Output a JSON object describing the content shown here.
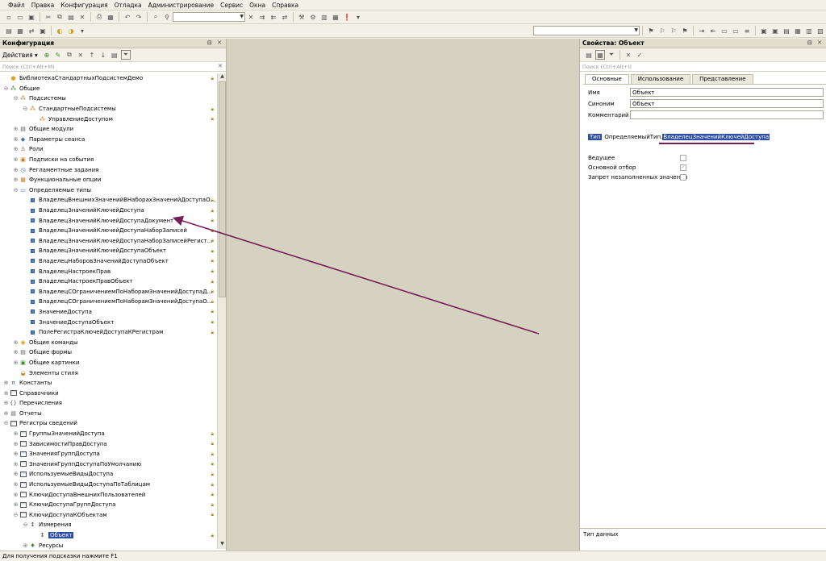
{
  "menu": [
    "Файл",
    "Правка",
    "Конфигурация",
    "Отладка",
    "Администрирование",
    "Сервис",
    "Окна",
    "Справка"
  ],
  "config_panel": {
    "title": "Конфигурация",
    "actions_label": "Действия ▾",
    "search_placeholder": "Поиск (Ctrl+Alt+M)"
  },
  "tree": [
    {
      "level": 0,
      "exp": "",
      "icon": "root-icon",
      "label": "БиблиотекаСтандартныхПодсистемДемо",
      "lock": true
    },
    {
      "level": 0,
      "exp": "⊖",
      "icon": "common-icon",
      "label": "Общие",
      "lock": false
    },
    {
      "level": 1,
      "exp": "⊖",
      "icon": "subsystems-icon",
      "label": "Подсистемы",
      "lock": false
    },
    {
      "level": 2,
      "exp": "⊖",
      "icon": "subsystem-icon",
      "label": "СтандартныеПодсистемы",
      "lock": true
    },
    {
      "level": 3,
      "exp": "",
      "icon": "subsystem-icon",
      "label": "УправлениеДоступом",
      "lock": true
    },
    {
      "level": 1,
      "exp": "⊕",
      "icon": "module-icon",
      "label": "Общие модули",
      "lock": false
    },
    {
      "level": 1,
      "exp": "⊕",
      "icon": "session-icon",
      "label": "Параметры сеанса",
      "lock": false
    },
    {
      "level": 1,
      "exp": "⊕",
      "icon": "roles-icon",
      "label": "Роли",
      "lock": false
    },
    {
      "level": 1,
      "exp": "⊕",
      "icon": "events-icon",
      "label": "Подписки на события",
      "lock": false
    },
    {
      "level": 1,
      "exp": "⊕",
      "icon": "jobs-icon",
      "label": "Регламентные задания",
      "lock": false
    },
    {
      "level": 1,
      "exp": "⊕",
      "icon": "options-icon",
      "label": "Функциональные опции",
      "lock": false
    },
    {
      "level": 1,
      "exp": "⊖",
      "icon": "types-icon",
      "label": "Определяемые типы",
      "lock": false
    },
    {
      "level": 2,
      "exp": "",
      "icon": "type-icon",
      "label": "ВладелецВнешнихЗначенийВНаборахЗначенийДоступаО...",
      "lock": true
    },
    {
      "level": 2,
      "exp": "",
      "icon": "type-icon",
      "label": "ВладелецЗначенийКлючейДоступа",
      "lock": true
    },
    {
      "level": 2,
      "exp": "",
      "icon": "type-icon",
      "label": "ВладелецЗначенийКлючейДоступаДокумент",
      "lock": true
    },
    {
      "level": 2,
      "exp": "",
      "icon": "type-icon",
      "label": "ВладелецЗначенийКлючейДоступаНаборЗаписей",
      "lock": true
    },
    {
      "level": 2,
      "exp": "",
      "icon": "type-icon",
      "label": "ВладелецЗначенийКлючейДоступаНаборЗаписейРегист...",
      "lock": true
    },
    {
      "level": 2,
      "exp": "",
      "icon": "type-icon",
      "label": "ВладелецЗначенийКлючейДоступаОбъект",
      "lock": true
    },
    {
      "level": 2,
      "exp": "",
      "icon": "type-icon",
      "label": "ВладелецНаборовЗначенийДоступаОбъект",
      "lock": true
    },
    {
      "level": 2,
      "exp": "",
      "icon": "type-icon",
      "label": "ВладелецНастроекПрав",
      "lock": true
    },
    {
      "level": 2,
      "exp": "",
      "icon": "type-icon",
      "label": "ВладелецНастроекПравОбъект",
      "lock": true
    },
    {
      "level": 2,
      "exp": "",
      "icon": "type-icon",
      "label": "ВладелецСОграничениемПоНаборамЗначенийДоступаД...",
      "lock": true
    },
    {
      "level": 2,
      "exp": "",
      "icon": "type-icon",
      "label": "ВладелецСОграничениемПоНаборамЗначенийДоступаО...",
      "lock": true
    },
    {
      "level": 2,
      "exp": "",
      "icon": "type-icon",
      "label": "ЗначениеДоступа",
      "lock": true
    },
    {
      "level": 2,
      "exp": "",
      "icon": "type-icon",
      "label": "ЗначениеДоступаОбъект",
      "lock": true
    },
    {
      "level": 2,
      "exp": "",
      "icon": "type-icon",
      "label": "ПолеРегистраКлючейДоступаКРегистрам",
      "lock": true
    },
    {
      "level": 1,
      "exp": "⊕",
      "icon": "commands-icon",
      "label": "Общие команды",
      "lock": false
    },
    {
      "level": 1,
      "exp": "⊕",
      "icon": "forms-icon",
      "label": "Общие формы",
      "lock": false
    },
    {
      "level": 1,
      "exp": "⊕",
      "icon": "pictures-icon",
      "label": "Общие картинки",
      "lock": false
    },
    {
      "level": 1,
      "exp": "",
      "icon": "styles-icon",
      "label": "Элементы стиля",
      "lock": false
    },
    {
      "level": 0,
      "exp": "⊕",
      "icon": "constants-icon",
      "label": "Константы",
      "lock": false
    },
    {
      "level": 0,
      "exp": "⊕",
      "icon": "catalogs-icon",
      "label": "Справочники",
      "lock": false
    },
    {
      "level": 0,
      "exp": "⊕",
      "icon": "enums-icon",
      "label": "Перечисления",
      "lock": false
    },
    {
      "level": 0,
      "exp": "⊕",
      "icon": "reports-icon",
      "label": "Отчеты",
      "lock": false
    },
    {
      "level": 0,
      "exp": "⊖",
      "icon": "registers-icon",
      "label": "Регистры сведений",
      "lock": false
    },
    {
      "level": 1,
      "exp": "⊕",
      "icon": "register-icon",
      "label": "ГруппыЗначенийДоступа",
      "lock": true
    },
    {
      "level": 1,
      "exp": "⊕",
      "icon": "register-icon",
      "label": "ЗависимостиПравДоступа",
      "lock": true
    },
    {
      "level": 1,
      "exp": "⊕",
      "icon": "register-icon",
      "label": "ЗначенияГруппДоступа",
      "lock": true
    },
    {
      "level": 1,
      "exp": "⊕",
      "icon": "register-icon",
      "label": "ЗначенияГруппДоступаПоУмолчанию",
      "lock": true
    },
    {
      "level": 1,
      "exp": "⊕",
      "icon": "register-icon",
      "label": "ИспользуемыеВидыДоступа",
      "lock": true
    },
    {
      "level": 1,
      "exp": "⊕",
      "icon": "register-icon",
      "label": "ИспользуемыеВидыДоступаПоТаблицам",
      "lock": true
    },
    {
      "level": 1,
      "exp": "⊕",
      "icon": "register-icon",
      "label": "КлючиДоступаВнешнихПользователей",
      "lock": true
    },
    {
      "level": 1,
      "exp": "⊕",
      "icon": "register-icon",
      "label": "КлючиДоступаГруппДоступа",
      "lock": true
    },
    {
      "level": 1,
      "exp": "⊖",
      "icon": "register-icon",
      "label": "КлючиДоступаКОбъектам",
      "lock": true
    },
    {
      "level": 2,
      "exp": "⊖",
      "icon": "dimensions-icon",
      "label": "Измерения",
      "lock": false
    },
    {
      "level": 3,
      "exp": "",
      "icon": "dimension-icon",
      "label": "Объект",
      "lock": true,
      "selected": true
    },
    {
      "level": 2,
      "exp": "⊕",
      "icon": "resources-icon",
      "label": "Ресурсы",
      "lock": false
    }
  ],
  "properties": {
    "title": "Свойства: Объект",
    "search_placeholder": "Поиск (Ctrl+Alt+I)",
    "tabs": [
      "Основные",
      "Использование",
      "Представление"
    ],
    "name_label": "Имя",
    "name_value": "Объект",
    "synonym_label": "Синоним",
    "synonym_value": "Объект",
    "comment_label": "Комментарий",
    "comment_value": "",
    "type_label": "Тип",
    "type_prefix": "ОпределяемыйТип.",
    "type_highlight": "ВладелецЗначенийКлючейДоступа",
    "checks": [
      {
        "label": "Ведущее",
        "checked": false
      },
      {
        "label": "Основной отбор",
        "checked": true
      },
      {
        "label": "Запрет незаполненных значений",
        "checked": false
      }
    ],
    "description": "Тип данных"
  },
  "status": "Для получения подсказки нажмите F1",
  "colors": {
    "selection": "#2d4fa3",
    "arrow": "#7a1d56",
    "center_bg": "#d6d2c1"
  }
}
